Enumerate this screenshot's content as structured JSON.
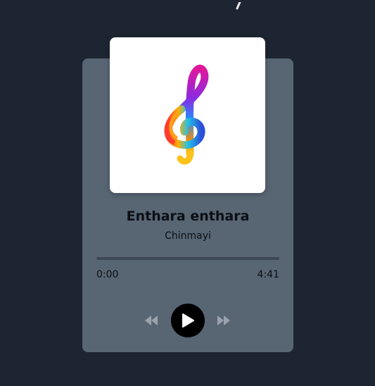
{
  "player": {
    "song_title": "Enthara enthara",
    "artist": "Chinmayi",
    "current_time": "0:00",
    "total_time": "4:41",
    "progress": 0
  },
  "icons": {
    "album_art": "treble-clef-icon",
    "rewind": "rewind-icon",
    "play": "play-icon",
    "forward": "fast-forward-icon"
  },
  "colors": {
    "background": "#1c2531",
    "card": "#586573",
    "controls_dim": "#9aa3ad"
  }
}
